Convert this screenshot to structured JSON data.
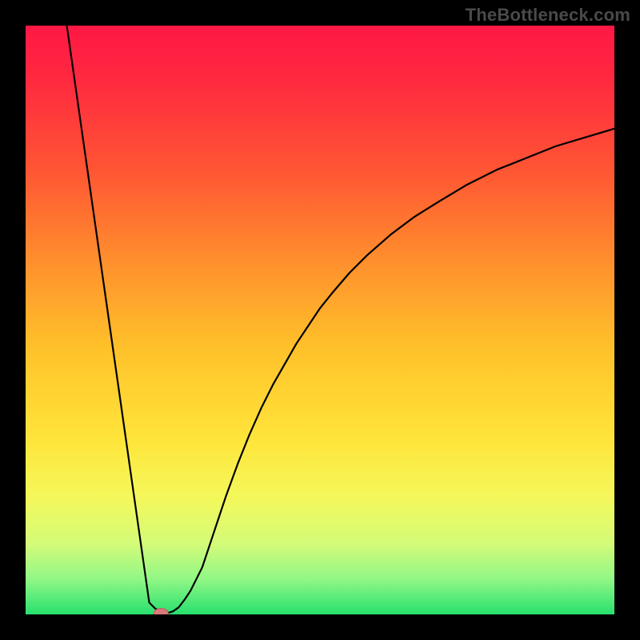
{
  "watermark": "TheBottleneck.com",
  "colors": {
    "frame": "#000000",
    "curve": "#000000",
    "marker_fill": "#d97b7b",
    "marker_stroke": "#c25a5a",
    "gradient_stops": [
      {
        "offset": 0.0,
        "color": "#ff1744"
      },
      {
        "offset": 0.1,
        "color": "#ff2b3f"
      },
      {
        "offset": 0.25,
        "color": "#ff5733"
      },
      {
        "offset": 0.4,
        "color": "#ff8f2d"
      },
      {
        "offset": 0.55,
        "color": "#ffc22a"
      },
      {
        "offset": 0.7,
        "color": "#ffe43a"
      },
      {
        "offset": 0.8,
        "color": "#f4f85a"
      },
      {
        "offset": 0.88,
        "color": "#d4fb78"
      },
      {
        "offset": 0.94,
        "color": "#91f786"
      },
      {
        "offset": 1.0,
        "color": "#28e06e"
      }
    ]
  },
  "chart_data": {
    "type": "line",
    "title": "",
    "xlabel": "",
    "ylabel": "",
    "xlim": [
      0,
      100
    ],
    "ylim": [
      0,
      100
    ],
    "x": [
      7,
      8,
      9,
      10,
      11,
      12,
      13,
      14,
      15,
      16,
      17,
      18,
      19,
      20,
      21,
      22,
      23,
      24,
      25,
      26,
      27,
      28,
      29,
      30,
      31,
      32,
      33,
      34,
      36,
      38,
      40,
      42,
      44,
      46,
      48,
      50,
      52,
      55,
      58,
      62,
      66,
      70,
      75,
      80,
      85,
      90,
      95,
      100
    ],
    "y": [
      100,
      93,
      86,
      79,
      72,
      65,
      58,
      51,
      44,
      37,
      30,
      23,
      16,
      9,
      2,
      1,
      0.5,
      0.2,
      0.5,
      1.2,
      2.5,
      4,
      6,
      8,
      11,
      14,
      17,
      20,
      25.5,
      30.5,
      35,
      39,
      42.5,
      46,
      49,
      52,
      54.5,
      58,
      61,
      64.5,
      67.5,
      70,
      73,
      75.5,
      77.5,
      79.5,
      81,
      82.5
    ],
    "marker": {
      "x": 23,
      "y": 0.2
    }
  }
}
